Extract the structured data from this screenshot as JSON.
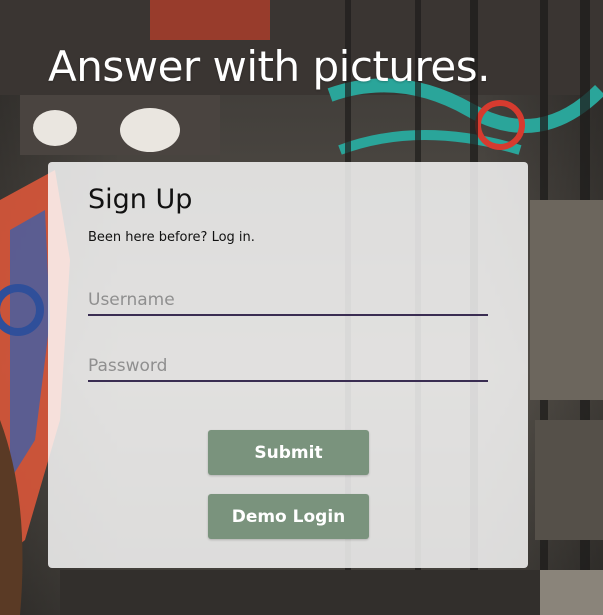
{
  "hero": {
    "headline": "Answer with pictures."
  },
  "form": {
    "title": "Sign Up",
    "login_link": "Been here before? Log in.",
    "username_placeholder": "Username",
    "password_placeholder": "Password",
    "submit_label": "Submit",
    "demo_label": "Demo Login"
  },
  "colors": {
    "button": "#7a937d",
    "input_underline": "#3a2d52",
    "card_background": "rgba(255,255,255,0.82)"
  }
}
